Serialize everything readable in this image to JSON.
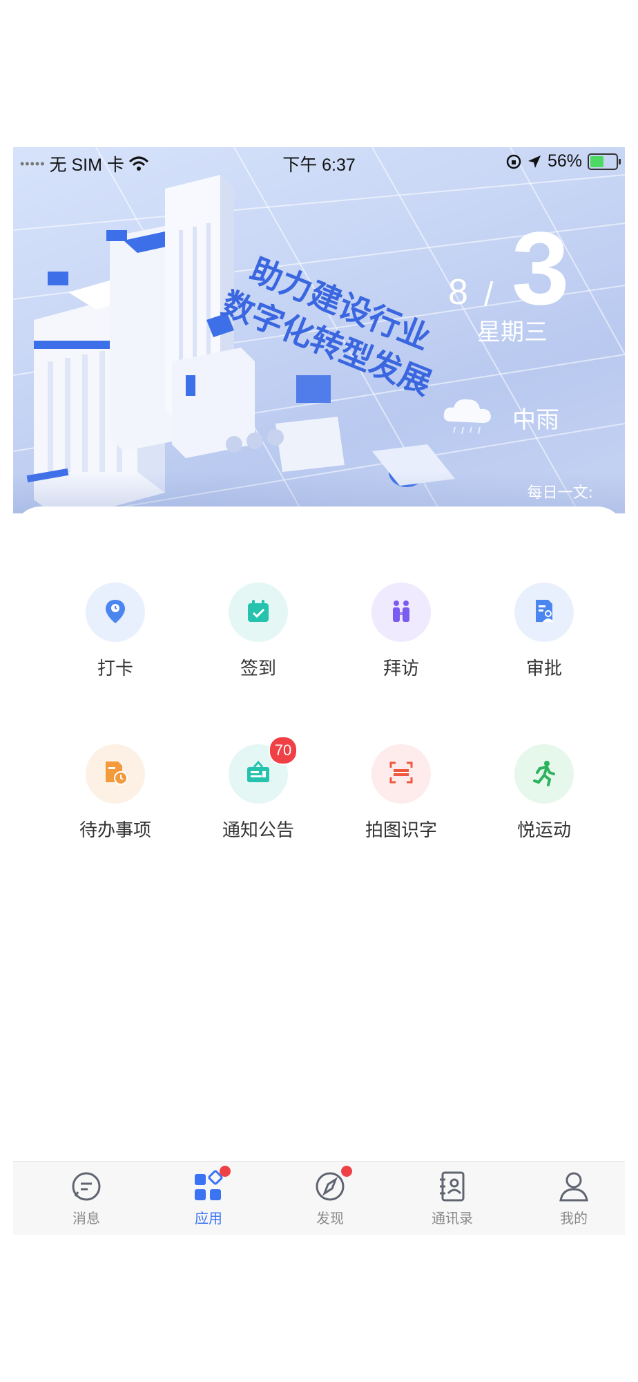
{
  "status_bar": {
    "signal": "•••••",
    "carrier": "无 SIM 卡",
    "time": "下午 6:37",
    "battery_percent": "56%",
    "battery_level": 0.56
  },
  "hero": {
    "month": "8",
    "slash": "/",
    "day": "3",
    "weekday": "星期三",
    "weather": "中雨",
    "daily_article": "每日一文:",
    "banner_text_line1": "助力建设行业",
    "banner_text_line2": "数字化转型发展"
  },
  "apps": [
    {
      "label": "打卡",
      "icon": "location-pin-icon",
      "bg": "#e9f0fd",
      "color": "#4b86f0"
    },
    {
      "label": "签到",
      "icon": "calendar-check-icon",
      "bg": "#e4f7f5",
      "color": "#25c2ad"
    },
    {
      "label": "拜访",
      "icon": "visit-people-icon",
      "bg": "#efeafd",
      "color": "#7b5cf0"
    },
    {
      "label": "审批",
      "icon": "approval-document-icon",
      "bg": "#e9f0fd",
      "color": "#4b86f0"
    },
    {
      "label": "待办事项",
      "icon": "todo-clock-icon",
      "bg": "#fdf1e6",
      "color": "#f39a3d"
    },
    {
      "label": "通知公告",
      "icon": "notice-board-icon",
      "bg": "#e4f7f5",
      "color": "#25c2ad",
      "badge": "70"
    },
    {
      "label": "拍图识字",
      "icon": "scan-text-icon",
      "bg": "#fdeceb",
      "color": "#f0573e"
    },
    {
      "label": "悦运动",
      "icon": "running-man-icon",
      "bg": "#e6f7ec",
      "color": "#2bb35c"
    }
  ],
  "tabs": [
    {
      "label": "消息",
      "icon": "message-icon",
      "active": false,
      "dot": false
    },
    {
      "label": "应用",
      "icon": "apps-grid-icon",
      "active": true,
      "dot": true
    },
    {
      "label": "发现",
      "icon": "compass-icon",
      "active": false,
      "dot": true
    },
    {
      "label": "通讯录",
      "icon": "contacts-book-icon",
      "active": false,
      "dot": false
    },
    {
      "label": "我的",
      "icon": "profile-icon",
      "active": false,
      "dot": false
    }
  ]
}
